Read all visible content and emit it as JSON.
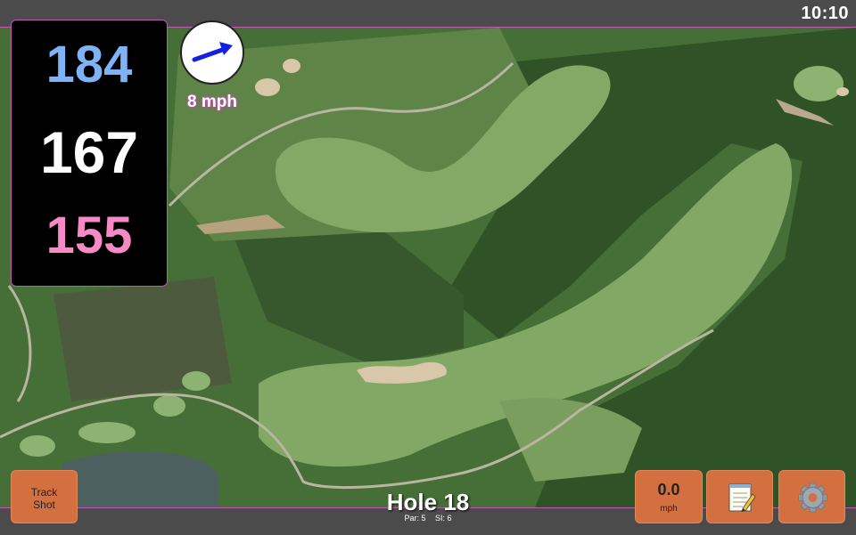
{
  "status": {
    "time": "10:10"
  },
  "yardages": {
    "back": "184",
    "center": "167",
    "front": "155"
  },
  "wind": {
    "speed_label": "8 mph",
    "icon": "wind-arrow-icon"
  },
  "buttons": {
    "track_shot_line1": "Track",
    "track_shot_line2": "Shot",
    "speed_value": "0.0",
    "speed_unit": "mph",
    "notes_icon": "notepad-icon",
    "settings_icon": "gear-icon"
  },
  "hole": {
    "title": "Hole 18",
    "par": "Par: 5",
    "si": "SI: 6"
  },
  "colors": {
    "accent": "#c05ab4",
    "button": "#d4703f",
    "back": "#7fb3f5",
    "front": "#f58ac4"
  }
}
